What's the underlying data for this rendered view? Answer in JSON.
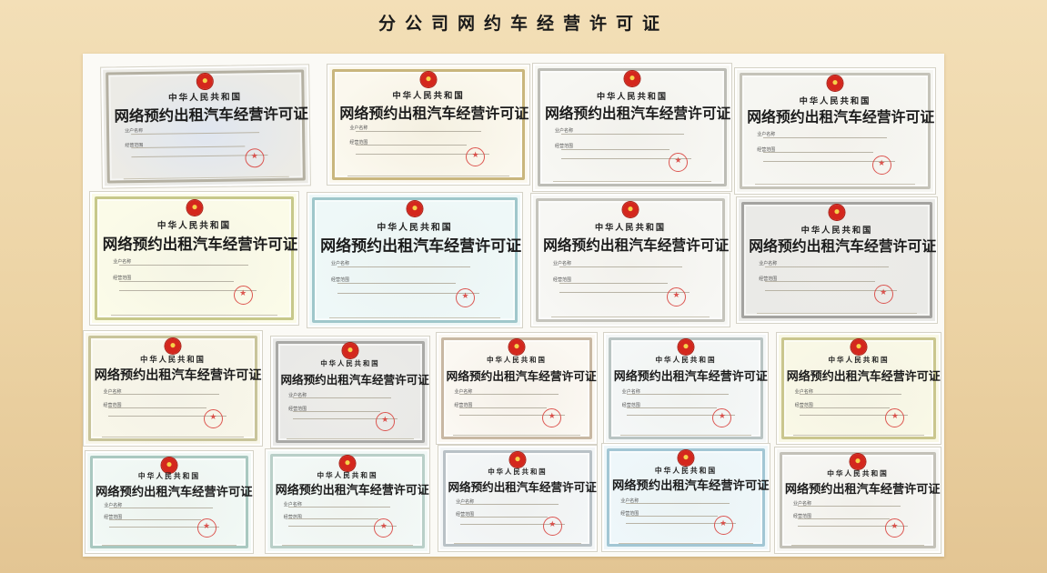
{
  "page": {
    "title": "分公司网约车经营许可证"
  },
  "cert_common": {
    "country": "中华人民共和国",
    "license_title": "网络预约出租汽车经营许可证",
    "label_operator": "业户名称",
    "label_scope": "经营范围"
  },
  "certificates": [
    {
      "frame": "#b4b0a2",
      "bg": "#ecebe6",
      "tint": "#a7bde3"
    },
    {
      "frame": "#c9b67d",
      "bg": "#fbf8ee",
      "tint": "#e7dcb8"
    },
    {
      "frame": "#bdbdb6",
      "bg": "#f7f7f3",
      "tint": "#dfdfd8"
    },
    {
      "frame": "#c5c3b9",
      "bg": "#f6f6f2",
      "tint": "#e2e0d7"
    },
    {
      "frame": "#c7c88a",
      "bg": "#fbfbe8",
      "tint": "#e8e9c3"
    },
    {
      "frame": "#9fc7cb",
      "bg": "#eef8f8",
      "tint": "#cde6e8"
    },
    {
      "frame": "#c5c4bc",
      "bg": "#f7f7f4",
      "tint": "#e0dfd8"
    },
    {
      "frame": "#a4a3a0",
      "bg": "#eaeae7",
      "tint": "#cfcfcb"
    },
    {
      "frame": "#c8c49a",
      "bg": "#f8f6e9",
      "tint": "#e5e2c8"
    },
    {
      "frame": "#a9a9a6",
      "bg": "#e9e9e7",
      "tint": "#d1d1cd"
    },
    {
      "frame": "#c8b8a3",
      "bg": "#fbf8f2",
      "tint": "#e8dccd"
    },
    {
      "frame": "#b9c4c3",
      "bg": "#f4f7f7",
      "tint": "#dbe3e3"
    },
    {
      "frame": "#cac68e",
      "bg": "#f9f8e6",
      "tint": "#e6e4c0"
    },
    {
      "frame": "#a9c8c0",
      "bg": "#f1f8f5",
      "tint": "#d2e6df"
    },
    {
      "frame": "#b9cfc8",
      "bg": "#f2f8f6",
      "tint": "#d8e7e2"
    },
    {
      "frame": "#b9c1c6",
      "bg": "#f3f6f7",
      "tint": "#d9e0e3"
    },
    {
      "frame": "#a2c6d4",
      "bg": "#eef7fa",
      "tint": "#cbe4ee"
    },
    {
      "frame": "#c3c1b8",
      "bg": "#f6f6f3",
      "tint": "#dfddd5"
    }
  ]
}
